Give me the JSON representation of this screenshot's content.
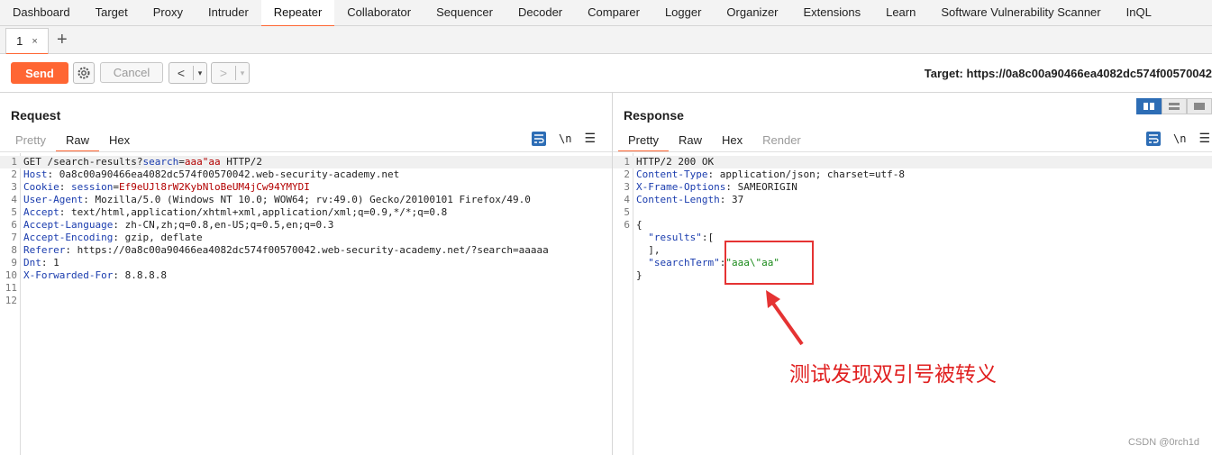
{
  "nav": [
    "Dashboard",
    "Target",
    "Proxy",
    "Intruder",
    "Repeater",
    "Collaborator",
    "Sequencer",
    "Decoder",
    "Comparer",
    "Logger",
    "Organizer",
    "Extensions",
    "Learn",
    "Software Vulnerability Scanner",
    "InQL"
  ],
  "subtab": {
    "label": "1",
    "close": "×",
    "plus": "+"
  },
  "toolbar": {
    "send": "Send",
    "cancel": "Cancel",
    "back": "<",
    "forward": ">",
    "dropdown": "▾",
    "target": "Target: https://0a8c00a90466ea4082dc574f00570042"
  },
  "request": {
    "title": "Request",
    "tabs": [
      "Pretty",
      "Raw",
      "Hex"
    ],
    "lines": [
      {
        "n": "1",
        "parts": [
          [
            "v",
            "GET /search-results?"
          ],
          [
            "k",
            "search"
          ],
          [
            "v",
            "="
          ],
          [
            "r",
            "aaa\"aa"
          ],
          [
            "v",
            " HTTP/2"
          ]
        ]
      },
      {
        "n": "2",
        "parts": [
          [
            "k",
            "Host"
          ],
          [
            "v",
            ": 0a8c00a90466ea4082dc574f00570042.web-security-academy.net"
          ]
        ]
      },
      {
        "n": "3",
        "parts": [
          [
            "k",
            "Cookie"
          ],
          [
            "v",
            ": "
          ],
          [
            "k",
            "session"
          ],
          [
            "v",
            "="
          ],
          [
            "r",
            "Ef9eUJl8rW2KybNloBeUM4jCw94YMYDI"
          ]
        ]
      },
      {
        "n": "4",
        "parts": [
          [
            "k",
            "User-Agent"
          ],
          [
            "v",
            ": Mozilla/5.0 (Windows NT 10.0; WOW64; rv:49.0) Gecko/20100101 Firefox/49.0"
          ]
        ]
      },
      {
        "n": "5",
        "parts": [
          [
            "k",
            "Accept"
          ],
          [
            "v",
            ": text/html,application/xhtml+xml,application/xml;q=0.9,*/*;q=0.8"
          ]
        ]
      },
      {
        "n": "6",
        "parts": [
          [
            "k",
            "Accept-Language"
          ],
          [
            "v",
            ": zh-CN,zh;q=0.8,en-US;q=0.5,en;q=0.3"
          ]
        ]
      },
      {
        "n": "7",
        "parts": [
          [
            "k",
            "Accept-Encoding"
          ],
          [
            "v",
            ": gzip, deflate"
          ]
        ]
      },
      {
        "n": "8",
        "parts": [
          [
            "k",
            "Referer"
          ],
          [
            "v",
            ": https://0a8c00a90466ea4082dc574f00570042.web-security-academy.net/?search=aaaaa"
          ]
        ]
      },
      {
        "n": "9",
        "parts": [
          [
            "k",
            "Dnt"
          ],
          [
            "v",
            ": 1"
          ]
        ]
      },
      {
        "n": "10",
        "parts": [
          [
            "k",
            "X-Forwarded-For"
          ],
          [
            "v",
            ": 8.8.8.8"
          ]
        ]
      },
      {
        "n": "11",
        "parts": []
      },
      {
        "n": "12",
        "parts": []
      }
    ]
  },
  "response": {
    "title": "Response",
    "tabs": [
      "Pretty",
      "Raw",
      "Hex",
      "Render"
    ],
    "lines": [
      {
        "n": "1",
        "parts": [
          [
            "v",
            "HTTP/2 200 OK"
          ]
        ]
      },
      {
        "n": "2",
        "parts": [
          [
            "k",
            "Content-Type"
          ],
          [
            "v",
            ": application/json; charset=utf-8"
          ]
        ]
      },
      {
        "n": "3",
        "parts": [
          [
            "k",
            "X-Frame-Options"
          ],
          [
            "v",
            ": SAMEORIGIN"
          ]
        ]
      },
      {
        "n": "4",
        "parts": [
          [
            "k",
            "Content-Length"
          ],
          [
            "v",
            ": 37"
          ]
        ]
      },
      {
        "n": "5",
        "parts": []
      },
      {
        "n": "6",
        "parts": [
          [
            "v",
            "{"
          ]
        ]
      },
      {
        "n": "",
        "parts": [
          [
            "v",
            "  "
          ],
          [
            "k",
            "\"results\""
          ],
          [
            "v",
            ":["
          ]
        ]
      },
      {
        "n": "",
        "parts": [
          [
            "v",
            "  ],"
          ]
        ]
      },
      {
        "n": "",
        "parts": [
          [
            "v",
            "  "
          ],
          [
            "k",
            "\"searchTerm\""
          ],
          [
            "v",
            ":"
          ],
          [
            "s",
            "\"aaa\\\"aa\""
          ]
        ]
      },
      {
        "n": "",
        "parts": [
          [
            "v",
            "}"
          ]
        ]
      }
    ]
  },
  "annotation": "测试发现双引号被转义",
  "watermark": "CSDN @0rch1d",
  "colors": {
    "accent": "#ff6633",
    "key": "#1a3cae",
    "value": "#b30000",
    "string": "#1a8a1a",
    "annotation": "#e02020"
  }
}
